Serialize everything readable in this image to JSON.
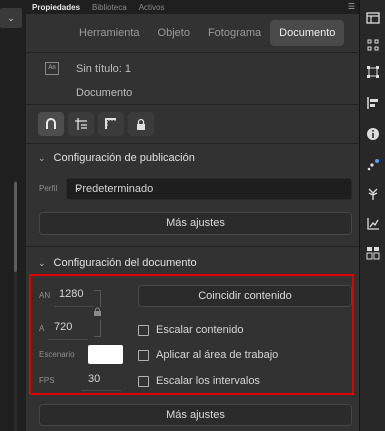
{
  "tabs": [
    {
      "label": "Propiedades"
    },
    {
      "label": "Biblioteca"
    },
    {
      "label": "Activos"
    }
  ],
  "segments": [
    "Herramienta",
    "Objeto",
    "Fotograma",
    "Documento"
  ],
  "doc": {
    "icon_text": "An",
    "title": "Sin título: 1",
    "name": "Documento"
  },
  "publish": {
    "header": "Configuración de publicación",
    "profile_label": "Perfil",
    "profile_value": "Predeterminado",
    "more_button": "Más ajustes"
  },
  "document": {
    "header": "Configuración del documento",
    "width_label": "AN",
    "width_value": "1280",
    "height_label": "A",
    "height_value": "720",
    "match_button": "Coincidir contenido",
    "stage_label": "Escenario",
    "stage_color": "#ffffff",
    "fps_label": "FPS",
    "fps_value": "30",
    "checkboxes": [
      {
        "label": "Escalar contenido",
        "checked": false
      },
      {
        "label": "Aplicar al área de trabajo",
        "checked": false
      },
      {
        "label": "Escalar los intervalos",
        "checked": false
      }
    ],
    "more_button": "Más ajustes"
  },
  "colors": {
    "panel_bg": "#323232",
    "highlight_border": "#e00000",
    "rail_icon_blue": "#4a9eff"
  }
}
